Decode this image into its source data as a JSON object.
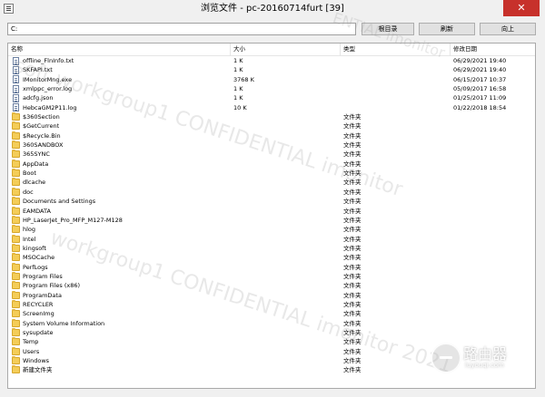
{
  "window": {
    "title": "浏览文件 - pc-20160714furt [39]",
    "close_glyph": "✕"
  },
  "toolbar": {
    "path": "C:",
    "root_label": "根目录",
    "refresh_label": "刷新",
    "up_label": "向上"
  },
  "columns": {
    "name": "名称",
    "size": "大小",
    "type": "类型",
    "date": "修改日期"
  },
  "rows": [
    {
      "name": "offline_FlnInfo.txt",
      "size": "1 K",
      "type": "",
      "date": "06/29/2021 19:40",
      "kind": "file"
    },
    {
      "name": "SKFAPI.txt",
      "size": "1 K",
      "type": "",
      "date": "06/29/2021 19:40",
      "kind": "file"
    },
    {
      "name": "IMonitorMng.exe",
      "size": "3768 K",
      "type": "",
      "date": "06/15/2017 10:37",
      "kind": "file"
    },
    {
      "name": "xmlppc_error.log",
      "size": "1 K",
      "type": "",
      "date": "05/09/2017 16:58",
      "kind": "file"
    },
    {
      "name": "adcfg.json",
      "size": "1 K",
      "type": "",
      "date": "01/25/2017 11:09",
      "kind": "file"
    },
    {
      "name": "HebcaGM2P11.log",
      "size": "10 K",
      "type": "",
      "date": "01/22/2018 18:54",
      "kind": "file"
    },
    {
      "name": "$360Section",
      "size": "",
      "type": "文件夹",
      "date": "",
      "kind": "folder"
    },
    {
      "name": "$GetCurrent",
      "size": "",
      "type": "文件夹",
      "date": "",
      "kind": "folder"
    },
    {
      "name": "$Recycle.Bin",
      "size": "",
      "type": "文件夹",
      "date": "",
      "kind": "folder"
    },
    {
      "name": "360SANDBOX",
      "size": "",
      "type": "文件夹",
      "date": "",
      "kind": "folder"
    },
    {
      "name": "365SYNC",
      "size": "",
      "type": "文件夹",
      "date": "",
      "kind": "folder"
    },
    {
      "name": "AppData",
      "size": "",
      "type": "文件夹",
      "date": "",
      "kind": "folder"
    },
    {
      "name": "Boot",
      "size": "",
      "type": "文件夹",
      "date": "",
      "kind": "folder"
    },
    {
      "name": "dlcache",
      "size": "",
      "type": "文件夹",
      "date": "",
      "kind": "folder"
    },
    {
      "name": "doc",
      "size": "",
      "type": "文件夹",
      "date": "",
      "kind": "folder"
    },
    {
      "name": "Documents and Settings",
      "size": "",
      "type": "文件夹",
      "date": "",
      "kind": "folder"
    },
    {
      "name": "EAMDATA",
      "size": "",
      "type": "文件夹",
      "date": "",
      "kind": "folder"
    },
    {
      "name": "HP_LaserJet_Pro_MFP_M127-M128",
      "size": "",
      "type": "文件夹",
      "date": "",
      "kind": "folder"
    },
    {
      "name": "hlog",
      "size": "",
      "type": "文件夹",
      "date": "",
      "kind": "folder"
    },
    {
      "name": "Intel",
      "size": "",
      "type": "文件夹",
      "date": "",
      "kind": "folder"
    },
    {
      "name": "kingsoft",
      "size": "",
      "type": "文件夹",
      "date": "",
      "kind": "folder"
    },
    {
      "name": "MSOCache",
      "size": "",
      "type": "文件夹",
      "date": "",
      "kind": "folder"
    },
    {
      "name": "PerfLogs",
      "size": "",
      "type": "文件夹",
      "date": "",
      "kind": "folder"
    },
    {
      "name": "Program Files",
      "size": "",
      "type": "文件夹",
      "date": "",
      "kind": "folder"
    },
    {
      "name": "Program Files (x86)",
      "size": "",
      "type": "文件夹",
      "date": "",
      "kind": "folder"
    },
    {
      "name": "ProgramData",
      "size": "",
      "type": "文件夹",
      "date": "",
      "kind": "folder"
    },
    {
      "name": "RECYCLER",
      "size": "",
      "type": "文件夹",
      "date": "",
      "kind": "folder"
    },
    {
      "name": "ScreenImg",
      "size": "",
      "type": "文件夹",
      "date": "",
      "kind": "folder"
    },
    {
      "name": "System Volume Information",
      "size": "",
      "type": "文件夹",
      "date": "",
      "kind": "folder"
    },
    {
      "name": "sysupdate",
      "size": "",
      "type": "文件夹",
      "date": "",
      "kind": "folder"
    },
    {
      "name": "Temp",
      "size": "",
      "type": "文件夹",
      "date": "",
      "kind": "folder"
    },
    {
      "name": "Users",
      "size": "",
      "type": "文件夹",
      "date": "",
      "kind": "folder"
    },
    {
      "name": "Windows",
      "size": "",
      "type": "文件夹",
      "date": "",
      "kind": "folder"
    },
    {
      "name": "新建文件夹",
      "size": "",
      "type": "文件夹",
      "date": "",
      "kind": "folder"
    }
  ],
  "watermark": {
    "line1": "soft workgroup1 CONFIDENTIAL imonitor",
    "line2": "workgroup1 CONFIDENTIAL imonitor 2021",
    "line3": "ENTIAL imonitor"
  },
  "logo": {
    "text": "路由器",
    "sub": "luyouqi.com"
  }
}
